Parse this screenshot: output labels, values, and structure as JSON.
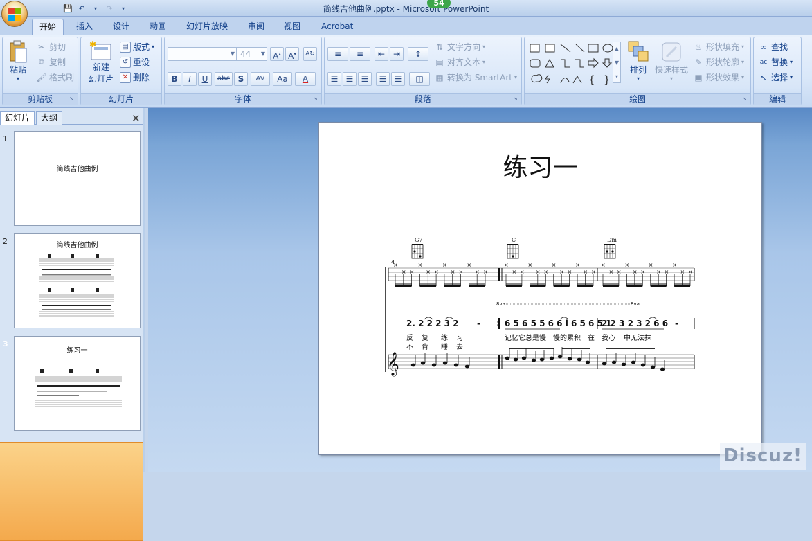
{
  "window": {
    "title": "简线吉他曲例.pptx - Microsoft PowerPoint",
    "notification_count": "54"
  },
  "tabs": [
    "开始",
    "插入",
    "设计",
    "动画",
    "幻灯片放映",
    "审阅",
    "视图",
    "Acrobat"
  ],
  "ribbon": {
    "clipboard": {
      "label": "剪贴板",
      "paste": "粘贴",
      "cut": "剪切",
      "copy": "复制",
      "format_painter": "格式刷"
    },
    "slides": {
      "label": "幻灯片",
      "new_slide_line1": "新建",
      "new_slide_line2": "幻灯片",
      "layout": "版式",
      "reset": "重设",
      "delete": "删除"
    },
    "font": {
      "label": "字体",
      "font_name": "",
      "font_size": "44",
      "bold": "B",
      "italic": "I",
      "underline": "U",
      "strike": "abc",
      "shadow": "S",
      "spacing": "AV",
      "case": "Aa",
      "color": "A"
    },
    "paragraph": {
      "label": "段落",
      "text_direction": "文字方向",
      "align_text": "对齐文本",
      "smartart": "转换为 SmartArt"
    },
    "drawing": {
      "label": "绘图",
      "arrange": "排列",
      "quick_styles": "快速样式",
      "shape_fill": "形状填充",
      "shape_outline": "形状轮廓",
      "shape_effects": "形状效果"
    },
    "editing": {
      "label": "编辑",
      "find": "查找",
      "replace": "替换",
      "select": "选择"
    }
  },
  "panel": {
    "tab_slides": "幻灯片",
    "tab_outline": "大纲",
    "slides": [
      {
        "num": "1",
        "title": "简线吉他曲例"
      },
      {
        "num": "2",
        "title": "简线吉他曲例"
      },
      {
        "num": "3",
        "title": "练习一"
      }
    ]
  },
  "slide": {
    "title": "练习一",
    "chords": [
      "G7",
      "C",
      "Dm"
    ],
    "time_sig": "4",
    "octave_marks": [
      "8va",
      "8va"
    ],
    "numbered_notation": [
      "2. 2 2 2 3 2",
      "-",
      "6 5 6 5 5 6 6 i 6 5 6 5 1",
      "2 2 3 2 3 2 6 6",
      "-"
    ],
    "lyrics_line1": [
      "反",
      "复",
      "练",
      "习",
      "记忆它总是慢",
      "慢的累积",
      "在",
      "我心",
      "中无法抹"
    ],
    "lyrics_line2": [
      "不",
      "肯",
      "睡",
      "去"
    ]
  },
  "watermark": "Discuz!"
}
